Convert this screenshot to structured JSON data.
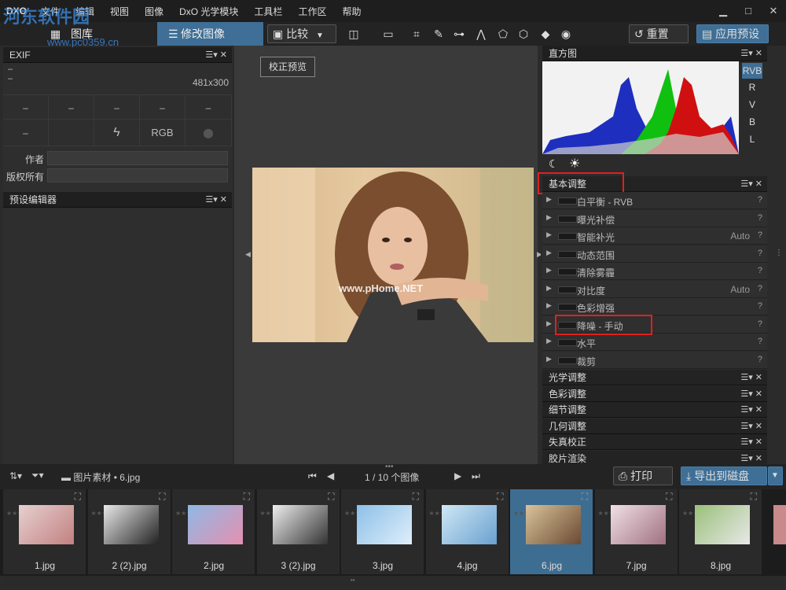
{
  "menu": {
    "logo": "DXO",
    "items": [
      "文件",
      "编辑",
      "视图",
      "图像",
      "DxO 光学模块",
      "工具栏",
      "工作区",
      "帮助"
    ]
  },
  "window_controls": [
    "▁",
    "□",
    "✕"
  ],
  "watermark": {
    "main": "河东软件园",
    "url": "www.pc0359.cn",
    "center": "www.pHome.NET"
  },
  "tabs": {
    "library": "图库",
    "edit": "修改图像"
  },
  "toolbar": {
    "compare": "比较",
    "reset": "重置",
    "apply_preset": "应用预设"
  },
  "exif": {
    "title": "EXIF",
    "line1": "–",
    "line2": "–",
    "dimensions": "481x300",
    "row1": [
      "–",
      "–",
      "–",
      "–",
      "–"
    ],
    "row2": [
      "–",
      "",
      "",
      "RGB",
      ""
    ],
    "author_label": "作者",
    "copyright_label": "版权所有"
  },
  "preset_editor": {
    "title": "预设编辑器"
  },
  "center": {
    "correct_preview": "校正预览"
  },
  "histogram": {
    "title": "直方图",
    "channels": [
      "RVB",
      "R",
      "V",
      "B",
      "L"
    ]
  },
  "basic": {
    "title": "基本调整",
    "rows": [
      {
        "label": "白平衡 - RVB",
        "value": "",
        "q": "?"
      },
      {
        "label": "曝光补偿",
        "value": "",
        "q": "?"
      },
      {
        "label": "智能补光",
        "value": "Auto",
        "q": "?"
      },
      {
        "label": "动态范围",
        "value": "",
        "q": "?"
      },
      {
        "label": "清除雾霾",
        "value": "",
        "q": "?"
      },
      {
        "label": "对比度",
        "value": "Auto",
        "q": "?"
      },
      {
        "label": "色彩增强",
        "value": "",
        "q": "?"
      },
      {
        "label": "降噪 - 手动",
        "value": "",
        "q": "?"
      },
      {
        "label": "水平",
        "value": "",
        "q": "?"
      },
      {
        "label": "裁剪",
        "value": "",
        "q": "?"
      }
    ]
  },
  "sections": [
    "光学调整",
    "色彩调整",
    "细节调整",
    "几何调整",
    "失真校正",
    "胶片渲染"
  ],
  "bottombar": {
    "folder": "图片素材",
    "file": "6.jpg",
    "counter": "1 / 10",
    "counter_label": "个图像",
    "print": "打印",
    "export": "导出到磁盘"
  },
  "filmstrip": [
    {
      "name": "1.jpg",
      "colors": [
        "#e6d0d0",
        "#c38080"
      ]
    },
    {
      "name": "2 (2).jpg",
      "colors": [
        "#e8e8e8",
        "#222"
      ]
    },
    {
      "name": "2.jpg",
      "colors": [
        "#8fb9e5",
        "#e58fb0"
      ]
    },
    {
      "name": "3 (2).jpg",
      "colors": [
        "#eee",
        "#333"
      ]
    },
    {
      "name": "3.jpg",
      "colors": [
        "#8cc0e8",
        "#dfeefa"
      ]
    },
    {
      "name": "4.jpg",
      "colors": [
        "#cfe8f5",
        "#6aa0d0"
      ]
    },
    {
      "name": "6.jpg",
      "colors": [
        "#d9c39a",
        "#6b4a32"
      ]
    },
    {
      "name": "7.jpg",
      "colors": [
        "#f0e0e6",
        "#a07080"
      ]
    },
    {
      "name": "8.jpg",
      "colors": [
        "#9ac07a",
        "#e8e8e8"
      ]
    }
  ],
  "panel_controls": "☰▾ ✕"
}
